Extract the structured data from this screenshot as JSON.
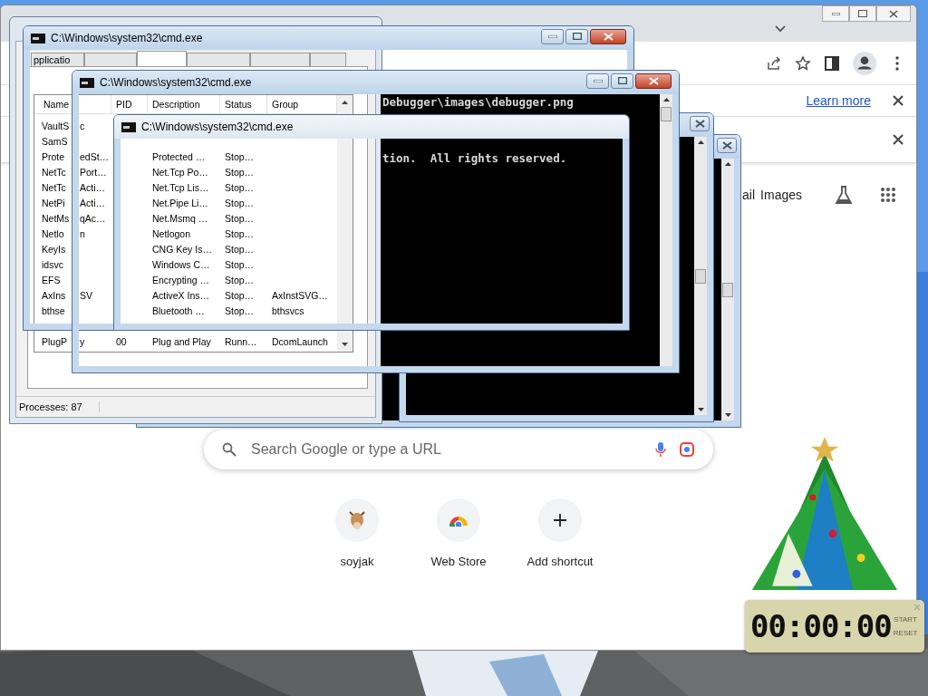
{
  "browser": {
    "infobar": {
      "link": "Learn more"
    },
    "links": [
      "ail",
      "Images"
    ],
    "search": {
      "placeholder": "Search Google or type a URL"
    },
    "shortcuts": [
      {
        "kind": "site",
        "label": "soyjak"
      },
      {
        "kind": "store",
        "label": "Web Store"
      },
      {
        "kind": "add",
        "label": "Add shortcut"
      }
    ]
  },
  "task_manager": {
    "tabs": [
      {
        "label": "pplicatio",
        "selected": false
      },
      {
        "selected": false
      },
      {
        "selected": true
      },
      {
        "selected": false
      },
      {
        "selected": false
      },
      {
        "selected": false
      }
    ],
    "columns": [
      "Name",
      "PID",
      "Description",
      "Status",
      "Group"
    ],
    "rows": [
      {
        "name": "VaultS",
        "name_tail": "c"
      },
      {
        "name": "SamS"
      },
      {
        "name": "Prote",
        "name_tail": "edSt…",
        "description": "Protected …",
        "status": "Stop…"
      },
      {
        "name": "NetTc",
        "name_tail": "Port…",
        "description": "Net.Tcp Po…",
        "status": "Stop…"
      },
      {
        "name": "NetTc",
        "name_tail": "Acti…",
        "description": "Net.Tcp Lis…",
        "status": "Stop…"
      },
      {
        "name": "NetPi",
        "name_tail": "Acti…",
        "description": "Net.Pipe Li…",
        "status": "Stop…"
      },
      {
        "name": "NetMs",
        "name_tail": "qAc…",
        "description": "Net.Msmq …",
        "status": "Stop…"
      },
      {
        "name": "Netlo",
        "name_tail": "n",
        "description": "Netlogon",
        "status": "Stop…"
      },
      {
        "name": "KeyIs",
        "description": "CNG Key Is…",
        "status": "Stop…"
      },
      {
        "name": "idsvc",
        "description": "Windows C…",
        "status": "Stop…"
      },
      {
        "name": "EFS",
        "description": "Encrypting …",
        "status": "Stop…"
      },
      {
        "name": "AxIns",
        "name_tail": "SV",
        "description": "ActiveX Ins…",
        "status": "Stop…",
        "group": "AxInstSVG…"
      },
      {
        "name": "bthse",
        "description": "Bluetooth …",
        "status": "Stop…",
        "group": "bthsvcs"
      },
      {
        "name": "PlugP",
        "name_tail": "y",
        "pid": "00",
        "description": "Plug and Play",
        "status": "Runn…",
        "group": "DcomLaunch"
      }
    ],
    "status": "Processes: 87"
  },
  "cmd_windows": [
    {
      "title": "C:\\Windows\\system32\\cmd.exe"
    },
    {
      "title": "C:\\Windows\\system32\\cmd.exe",
      "lines": [
        "Debugger\\images\\debugger.png"
      ]
    },
    {
      "title": "C:\\Windows\\system32\\cmd.exe",
      "lines": [
        "tion.  All rights reserved."
      ]
    }
  ],
  "timer": {
    "display": "00:00:00",
    "buttons": [
      "START",
      "RESET"
    ]
  }
}
